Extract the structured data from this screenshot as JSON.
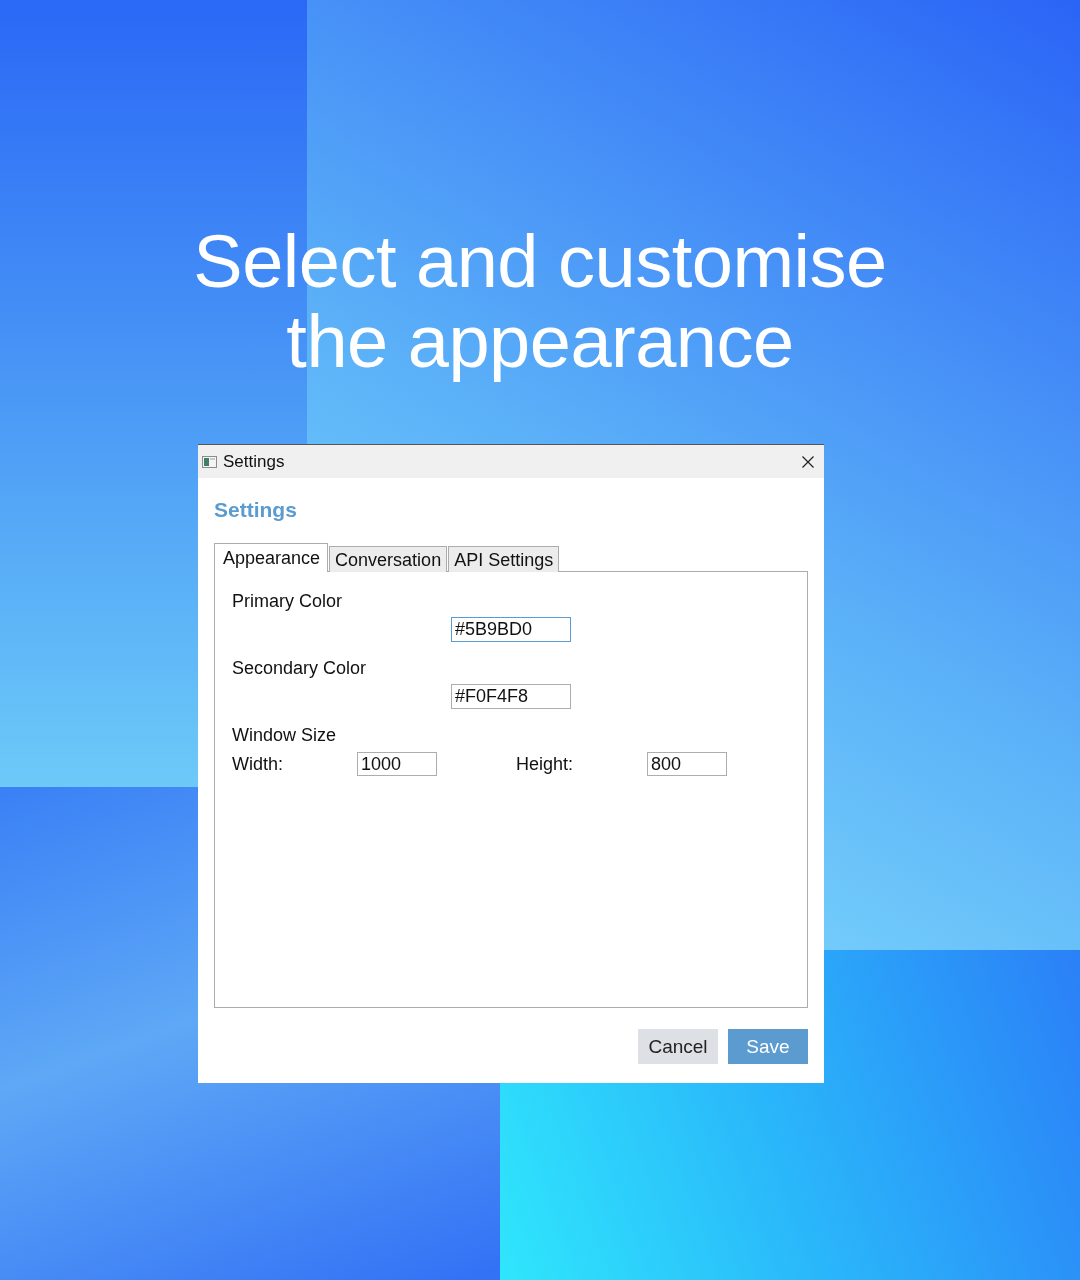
{
  "headline": "Select and customise the appearance",
  "window": {
    "title": "Settings"
  },
  "heading": "Settings",
  "tabs": [
    {
      "label": "Appearance",
      "selected": true
    },
    {
      "label": "Conversation",
      "selected": false
    },
    {
      "label": "API Settings",
      "selected": false
    }
  ],
  "fields": [
    {
      "label": "Primary Color",
      "value": "#5B9BD0",
      "focused": true
    },
    {
      "label": "Secondary Color",
      "value": "#F0F4F8",
      "focused": false
    }
  ],
  "window_size": {
    "label": "Window Size",
    "fields": [
      {
        "label": "Width:",
        "value": "1000",
        "focused": false
      },
      {
        "label": "Height:",
        "value": "800",
        "focused": false
      }
    ]
  },
  "buttons": [
    {
      "label": "Cancel",
      "kind": "secondary"
    },
    {
      "label": "Save",
      "kind": "primary"
    }
  ]
}
